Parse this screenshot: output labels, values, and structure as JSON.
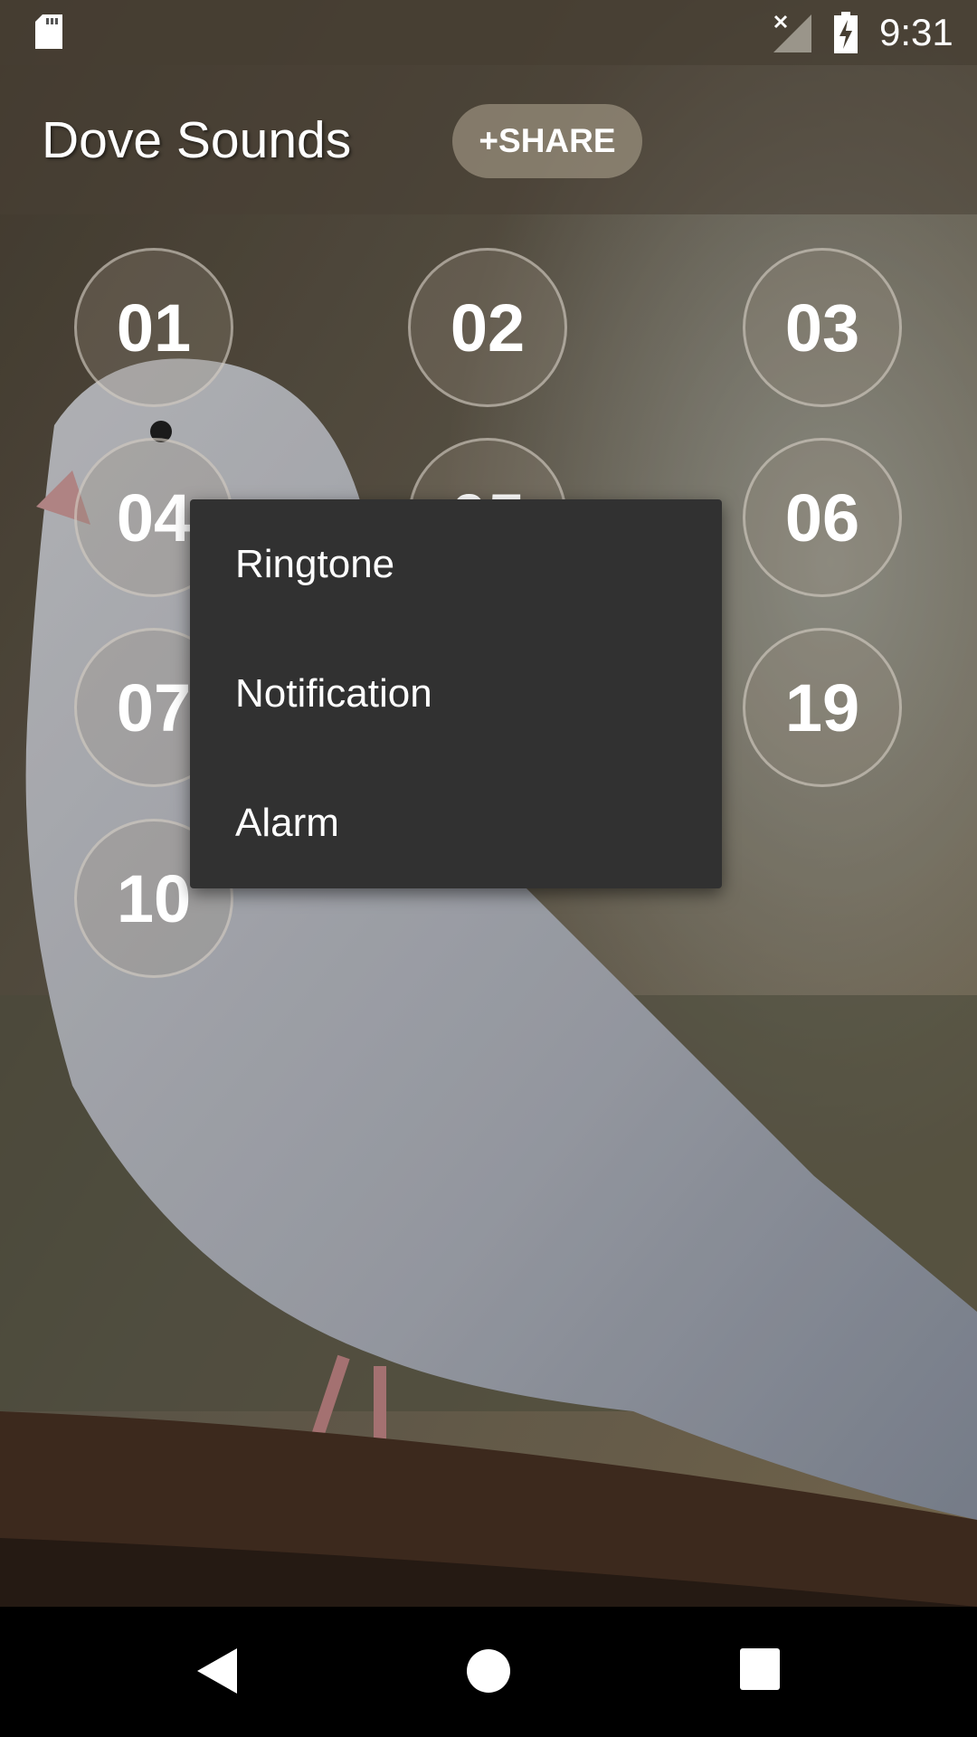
{
  "status_bar": {
    "time": "9:31",
    "icons": [
      "sd-card-icon",
      "no-signal-icon",
      "battery-charging-icon"
    ]
  },
  "app_bar": {
    "title": "Dove Sounds",
    "share_label": "+SHARE"
  },
  "sound_buttons": [
    "01",
    "02",
    "03",
    "04",
    "05",
    "06",
    "07",
    "19",
    "10"
  ],
  "popup_menu": {
    "items": [
      "Ringtone",
      "Notification",
      "Alarm"
    ]
  },
  "nav_bar": {
    "icons": [
      "back-icon",
      "home-icon",
      "recents-icon"
    ]
  },
  "colors": {
    "menu_bg": "#313131",
    "status_bar": "#463e32"
  }
}
